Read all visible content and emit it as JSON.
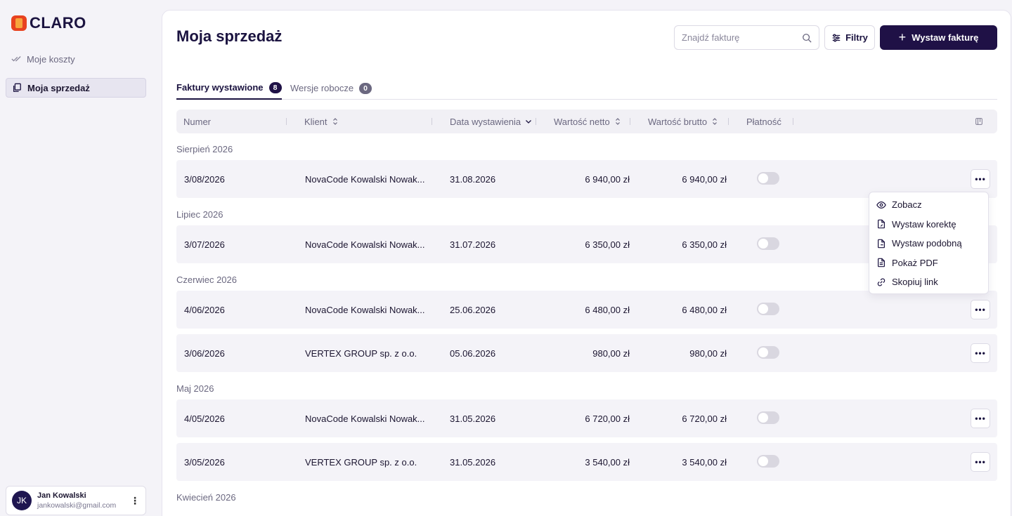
{
  "app": {
    "name": "CLARO"
  },
  "sidebar": {
    "items": [
      {
        "label": "Moje koszty",
        "active": false
      },
      {
        "label": "Moja sprzedaż",
        "active": true
      }
    ]
  },
  "user": {
    "initials": "JK",
    "name": "Jan Kowalski",
    "email": "jankowalski@gmail.com"
  },
  "header": {
    "title": "Moja sprzedaż",
    "search_placeholder": "Znajdź fakturę",
    "filter_label": "Filtry",
    "primary_label": "Wystaw fakturę"
  },
  "tabs": [
    {
      "label": "Faktury wystawione",
      "count": "8",
      "active": true
    },
    {
      "label": "Wersje robocze",
      "count": "0",
      "active": false
    }
  ],
  "table": {
    "columns": [
      "Numer",
      "Klient",
      "Data wystawienia",
      "Wartość netto",
      "Wartość brutto",
      "Płatność"
    ],
    "groups": [
      {
        "label": "Sierpień 2026",
        "rows": [
          {
            "numer": "3/08/2026",
            "klient": "NovaCode Kowalski Nowak...",
            "data": "31.08.2026",
            "netto": "6 940,00 zł",
            "brutto": "6 940,00 zł",
            "paid": false
          }
        ]
      },
      {
        "label": "Lipiec 2026",
        "rows": [
          {
            "numer": "3/07/2026",
            "klient": "NovaCode Kowalski Nowak...",
            "data": "31.07.2026",
            "netto": "6 350,00 zł",
            "brutto": "6 350,00 zł",
            "paid": false
          }
        ]
      },
      {
        "label": "Czerwiec 2026",
        "rows": [
          {
            "numer": "4/06/2026",
            "klient": "NovaCode Kowalski Nowak...",
            "data": "25.06.2026",
            "netto": "6 480,00 zł",
            "brutto": "6 480,00 zł",
            "paid": false
          },
          {
            "numer": "3/06/2026",
            "klient": "VERTEX GROUP sp. z o.o.",
            "data": "05.06.2026",
            "netto": "980,00 zł",
            "brutto": "980,00 zł",
            "paid": false
          }
        ]
      },
      {
        "label": "Maj 2026",
        "rows": [
          {
            "numer": "4/05/2026",
            "klient": "NovaCode Kowalski Nowak...",
            "data": "31.05.2026",
            "netto": "6 720,00 zł",
            "brutto": "6 720,00 zł",
            "paid": false
          },
          {
            "numer": "3/05/2026",
            "klient": "VERTEX GROUP sp. z o.o.",
            "data": "31.05.2026",
            "netto": "3 540,00 zł",
            "brutto": "3 540,00 zł",
            "paid": false
          }
        ]
      },
      {
        "label": "Kwiecień 2026",
        "rows": []
      }
    ]
  },
  "row_menu": {
    "icon": "more-dots-icon",
    "items": [
      {
        "label": "Zobacz",
        "icon": "eye-icon"
      },
      {
        "label": "Wystaw korektę",
        "icon": "file-edit-icon"
      },
      {
        "label": "Wystaw podobną",
        "icon": "file-copy-icon"
      },
      {
        "label": "Pokaż PDF",
        "icon": "file-text-icon"
      },
      {
        "label": "Skopiuj link",
        "icon": "link-icon"
      }
    ]
  },
  "colors": {
    "primary": "#1f1146",
    "accent": "#e8421f"
  }
}
